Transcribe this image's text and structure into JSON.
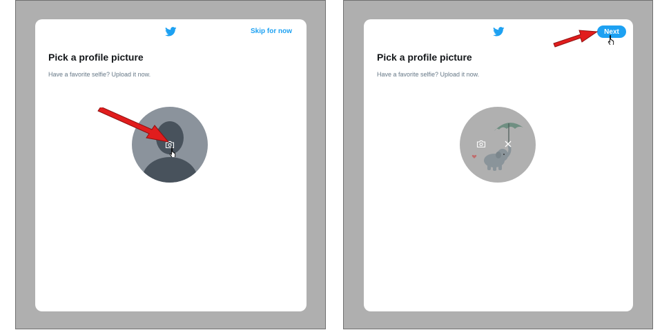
{
  "left_step": {
    "skip_label": "Skip for now",
    "title": "Pick a profile picture",
    "subtitle": "Have a favorite selfie? Upload it now."
  },
  "right_step": {
    "next_label": "Next",
    "title": "Pick a profile picture",
    "subtitle": "Have a favorite selfie? Upload it now."
  },
  "colors": {
    "twitter_blue": "#1da1f2",
    "backdrop": "#afafaf",
    "annotation_arrow": "#e11d1d"
  },
  "icons": [
    "twitter-bird-icon",
    "camera-icon",
    "close-icon",
    "hand-pointer-icon",
    "red-arrow-annotation"
  ]
}
